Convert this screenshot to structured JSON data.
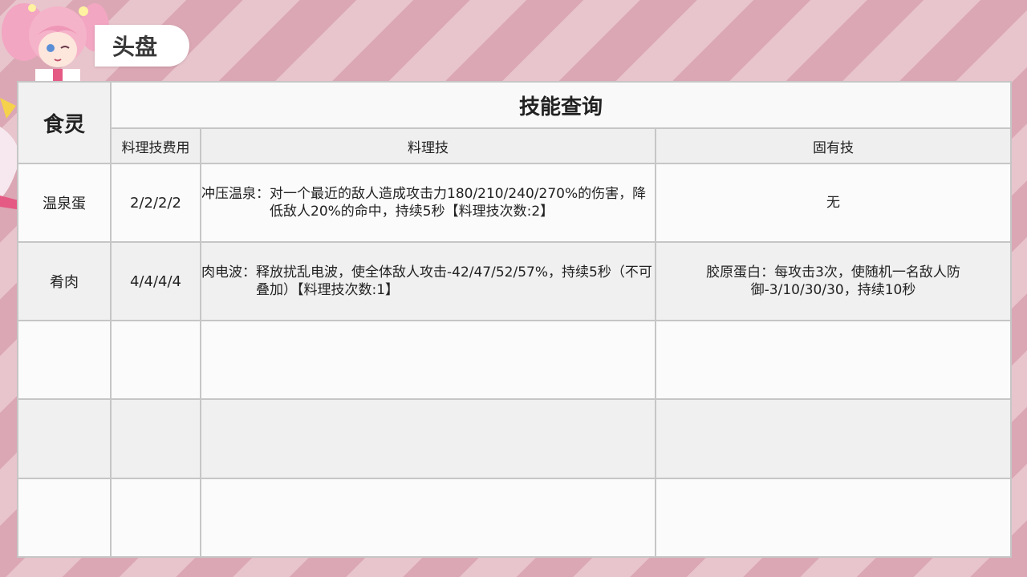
{
  "section_title": "头盘",
  "table": {
    "name_header": "食灵",
    "title": "技能查询",
    "subheaders": {
      "cost": "料理技费用",
      "cooking_skill": "料理技",
      "inherent_skill": "固有技"
    },
    "rows": [
      {
        "name": "温泉蛋",
        "cost": "2/2/2/2",
        "cooking_label": "冲压温泉：",
        "cooking_text": "对一个最近的敌人造成攻击力180/210/240/270%的伤害，降低敌人20%的命中，持续5秒【料理技次数:2】",
        "inherent": "无"
      },
      {
        "name": "肴肉",
        "cost": "4/4/4/4",
        "cooking_label": "肉电波：",
        "cooking_text": "释放扰乱电波，使全体敌人攻击-42/47/52/57%，持续5秒（不可叠加）【料理技次数:1】",
        "inherent": "胶原蛋白：每攻击3次，使随机一名敌人防御-3/10/30/30，持续10秒"
      },
      {
        "name": "",
        "cost": "",
        "cooking_label": "",
        "cooking_text": "",
        "inherent": ""
      },
      {
        "name": "",
        "cost": "",
        "cooking_label": "",
        "cooking_text": "",
        "inherent": ""
      },
      {
        "name": "",
        "cost": "",
        "cooking_label": "",
        "cooking_text": "",
        "inherent": ""
      }
    ]
  }
}
